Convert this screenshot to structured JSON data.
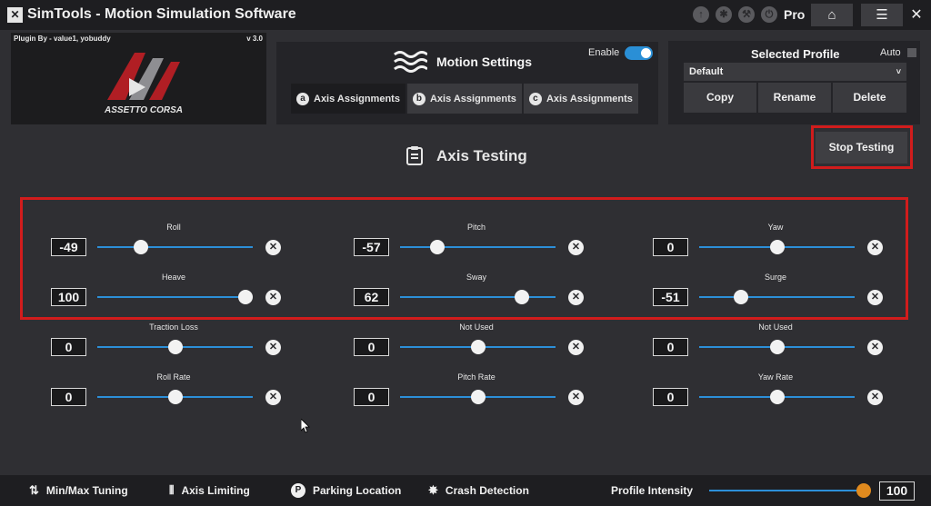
{
  "app": {
    "title": "SimTools - Motion Simulation Software",
    "logo_glyph": "✕",
    "edition": "Pro"
  },
  "titlebar": {
    "icons": [
      "arrow-up-icon",
      "gear-icon",
      "wrench-icon",
      "power-icon"
    ],
    "home_glyph": "⌂",
    "menu_glyph": "☰",
    "close_glyph": "✕"
  },
  "plugin": {
    "author": "Plugin By - value1, yobuddy",
    "version": "v 3.0",
    "game_logo_text": "ASSETTO CORSA"
  },
  "motion": {
    "title": "Motion Settings",
    "enable_label": "Enable",
    "enabled": true,
    "tabs": [
      {
        "badge": "a",
        "label": "Axis Assignments",
        "active": true
      },
      {
        "badge": "b",
        "label": "Axis Assignments",
        "active": false
      },
      {
        "badge": "c",
        "label": "Axis Assignments",
        "active": false
      }
    ]
  },
  "profile": {
    "title": "Selected Profile",
    "auto_label": "Auto",
    "auto_checked": false,
    "selected": "Default",
    "copy_label": "Copy",
    "rename_label": "Rename",
    "delete_label": "Delete"
  },
  "axis_testing": {
    "title": "Axis Testing",
    "stop_label": "Stop Testing",
    "reset_glyph": "✕",
    "slider_range": [
      -100,
      100
    ],
    "rows": [
      [
        {
          "label": "Roll",
          "value": -49
        },
        {
          "label": "Pitch",
          "value": -57
        },
        {
          "label": "Yaw",
          "value": 0
        }
      ],
      [
        {
          "label": "Heave",
          "value": 100
        },
        {
          "label": "Sway",
          "value": 62
        },
        {
          "label": "Surge",
          "value": -51
        }
      ],
      [
        {
          "label": "Traction Loss",
          "value": 0
        },
        {
          "label": "Not Used",
          "value": 0
        },
        {
          "label": "Not Used",
          "value": 0
        }
      ],
      [
        {
          "label": "Roll Rate",
          "value": 0
        },
        {
          "label": "Pitch Rate",
          "value": 0
        },
        {
          "label": "Yaw Rate",
          "value": 0
        }
      ]
    ]
  },
  "bottom": {
    "items": [
      {
        "icon": "⇅",
        "label": "Min/Max Tuning"
      },
      {
        "icon": "⫴",
        "label": "Axis Limiting"
      },
      {
        "icon": "P",
        "label": "Parking Location"
      },
      {
        "icon": "✸",
        "label": "Crash Detection"
      }
    ],
    "intensity_label": "Profile Intensity",
    "intensity_value": 100,
    "intensity_max": 100
  },
  "colors": {
    "accent_blue": "#2c8fd8",
    "highlight_red": "#d11c1c",
    "intensity_thumb": "#e08a1e"
  }
}
